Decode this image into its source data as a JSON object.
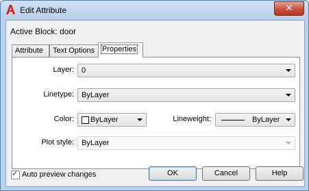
{
  "window": {
    "title": "Edit Attribute",
    "close_label": "✕"
  },
  "active_block_label": "Active Block: door",
  "tabs": [
    {
      "label": "Attribute"
    },
    {
      "label": "Text Options"
    },
    {
      "label": "Properties"
    }
  ],
  "properties": {
    "layer_label": "Layer:",
    "layer_value": "0",
    "linetype_label": "Linetype:",
    "linetype_value": "ByLayer",
    "color_label": "Color:",
    "color_value": "ByLayer",
    "lineweight_label": "Lineweight:",
    "lineweight_value": "ByLayer",
    "plotstyle_label": "Plot style:",
    "plotstyle_value": "ByLayer"
  },
  "footer": {
    "auto_preview_label": "Auto preview changes",
    "auto_preview_checked": true,
    "ok_label": "OK",
    "cancel_label": "Cancel",
    "help_label": "Help"
  },
  "colors": {
    "accent": "#3c7fb1",
    "titlebar": "#b9d1ea",
    "close": "#c7503a"
  }
}
